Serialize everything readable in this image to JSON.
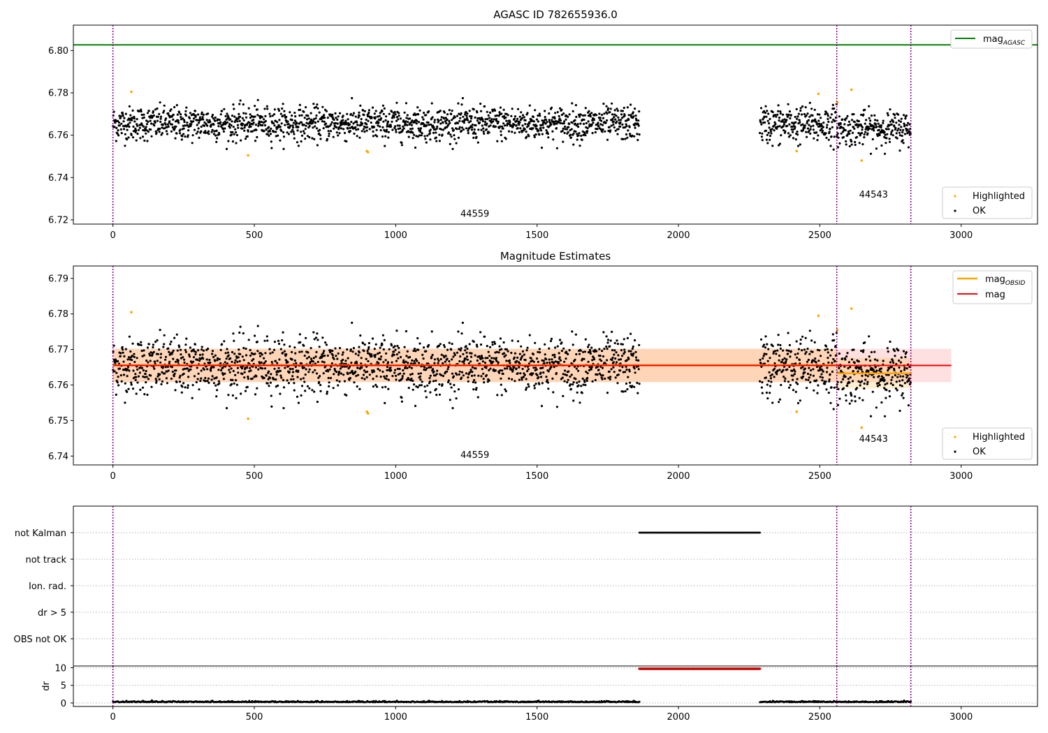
{
  "chart_data": [
    {
      "type": "scatter",
      "title": "AGASC ID 782655936.0",
      "xlim": [
        -140,
        3270
      ],
      "ylim": [
        6.718,
        6.812
      ],
      "yticks": [
        6.72,
        6.74,
        6.76,
        6.78,
        6.8
      ],
      "ytick_labels": [
        "6.72",
        "6.74",
        "6.76",
        "6.78",
        "6.80"
      ],
      "xticks": [
        0,
        500,
        1000,
        1500,
        2000,
        2500,
        3000
      ],
      "xtick_labels": [
        "0",
        "500",
        "1000",
        "1500",
        "2000",
        "2500",
        "3000"
      ],
      "vlines": [
        0,
        2560,
        2822
      ],
      "annotations": [
        {
          "text": "44559",
          "x": 1280,
          "y": 6.7215
        },
        {
          "text": "44543",
          "x": 2690,
          "y": 6.7305
        }
      ],
      "mag_agasc": 6.8027,
      "legend_top": [
        {
          "label_main": "mag",
          "label_sub": "AGASC",
          "color": "#008000"
        }
      ],
      "legend_bottom": [
        {
          "label": "Highlighted",
          "color": "#ffa500"
        },
        {
          "label": "OK",
          "color": "#000000"
        }
      ],
      "obs": [
        {
          "x0": 0,
          "x1": 1862,
          "mean": 6.7655,
          "sd": 0.004
        },
        {
          "x0": 2288,
          "x1": 2560,
          "mean": 6.765,
          "sd": 0.0045
        },
        {
          "x0": 2560,
          "x1": 2822,
          "mean": 6.7632,
          "sd": 0.004
        }
      ],
      "highlighted_points": [
        [
          65,
          6.7805
        ],
        [
          478,
          6.7505
        ],
        [
          898,
          6.7525
        ],
        [
          902,
          6.752
        ],
        [
          2418,
          6.7525
        ],
        [
          2495,
          6.7795
        ],
        [
          2562,
          6.7755
        ],
        [
          2612,
          6.7815
        ],
        [
          2648,
          6.748
        ]
      ]
    },
    {
      "type": "scatter",
      "title": "Magnitude Estimates",
      "xlim": [
        -140,
        3270
      ],
      "ylim": [
        6.7375,
        6.7935
      ],
      "yticks": [
        6.74,
        6.75,
        6.76,
        6.77,
        6.78,
        6.79
      ],
      "ytick_labels": [
        "6.74",
        "6.75",
        "6.76",
        "6.77",
        "6.78",
        "6.79"
      ],
      "xticks": [
        0,
        500,
        1000,
        1500,
        2000,
        2500,
        3000
      ],
      "xtick_labels": [
        "0",
        "500",
        "1000",
        "1500",
        "2000",
        "2500",
        "3000"
      ],
      "vlines": [
        0,
        2560,
        2822
      ],
      "annotations": [
        {
          "text": "44559",
          "x": 1280,
          "y": 6.7395
        },
        {
          "text": "44543",
          "x": 2690,
          "y": 6.744
        }
      ],
      "mag": 6.7655,
      "mag_band": [
        6.7608,
        6.7702
      ],
      "mag_x": [
        0,
        2965
      ],
      "mag_obsid": [
        {
          "x0": 0,
          "x1": 2560,
          "y": 6.7656,
          "band": [
            6.7608,
            6.7702
          ]
        },
        {
          "x0": 2560,
          "x1": 2822,
          "y": 6.7633,
          "band": [
            6.759,
            6.7676
          ]
        }
      ],
      "legend_top": [
        {
          "label_main": "mag",
          "label_sub": "OBSID",
          "color": "#ffa500"
        },
        {
          "label_main": "mag",
          "label_sub": "",
          "color": "#ff0000"
        }
      ],
      "legend_bottom": [
        {
          "label": "Highlighted",
          "color": "#ffa500"
        },
        {
          "label": "OK",
          "color": "#000000"
        }
      ]
    },
    {
      "type": "scatter",
      "title": "",
      "flags": [
        "not Kalman",
        "not track",
        "Ion. rad.",
        "dr > 5",
        "OBS not OK"
      ],
      "flag_segments": [
        {
          "flag": "not Kalman",
          "x0": 1862,
          "x1": 2288
        }
      ],
      "xlim": [
        -140,
        3270
      ],
      "vlines": [
        0,
        2560,
        2822
      ]
    },
    {
      "type": "scatter",
      "title": "",
      "ylabel": "dr",
      "ylim": [
        -1,
        10.5
      ],
      "yticks": [
        0,
        5,
        10
      ],
      "ytick_labels": [
        "0",
        "5",
        "10"
      ],
      "xlim": [
        -140,
        3270
      ],
      "xticks": [
        0,
        500,
        1000,
        1500,
        2000,
        2500,
        3000
      ],
      "xtick_labels": [
        "0",
        "500",
        "1000",
        "1500",
        "2000",
        "2500",
        "3000"
      ],
      "vlines": [
        0,
        2560,
        2822
      ],
      "dr_segments": [
        {
          "x0": 0,
          "x1": 1862,
          "y": 0.2
        },
        {
          "x0": 2288,
          "x1": 2822,
          "y": 0.2
        }
      ],
      "dr_flagged_segment": {
        "x0": 1862,
        "x1": 2288,
        "y": 9.7
      }
    }
  ]
}
